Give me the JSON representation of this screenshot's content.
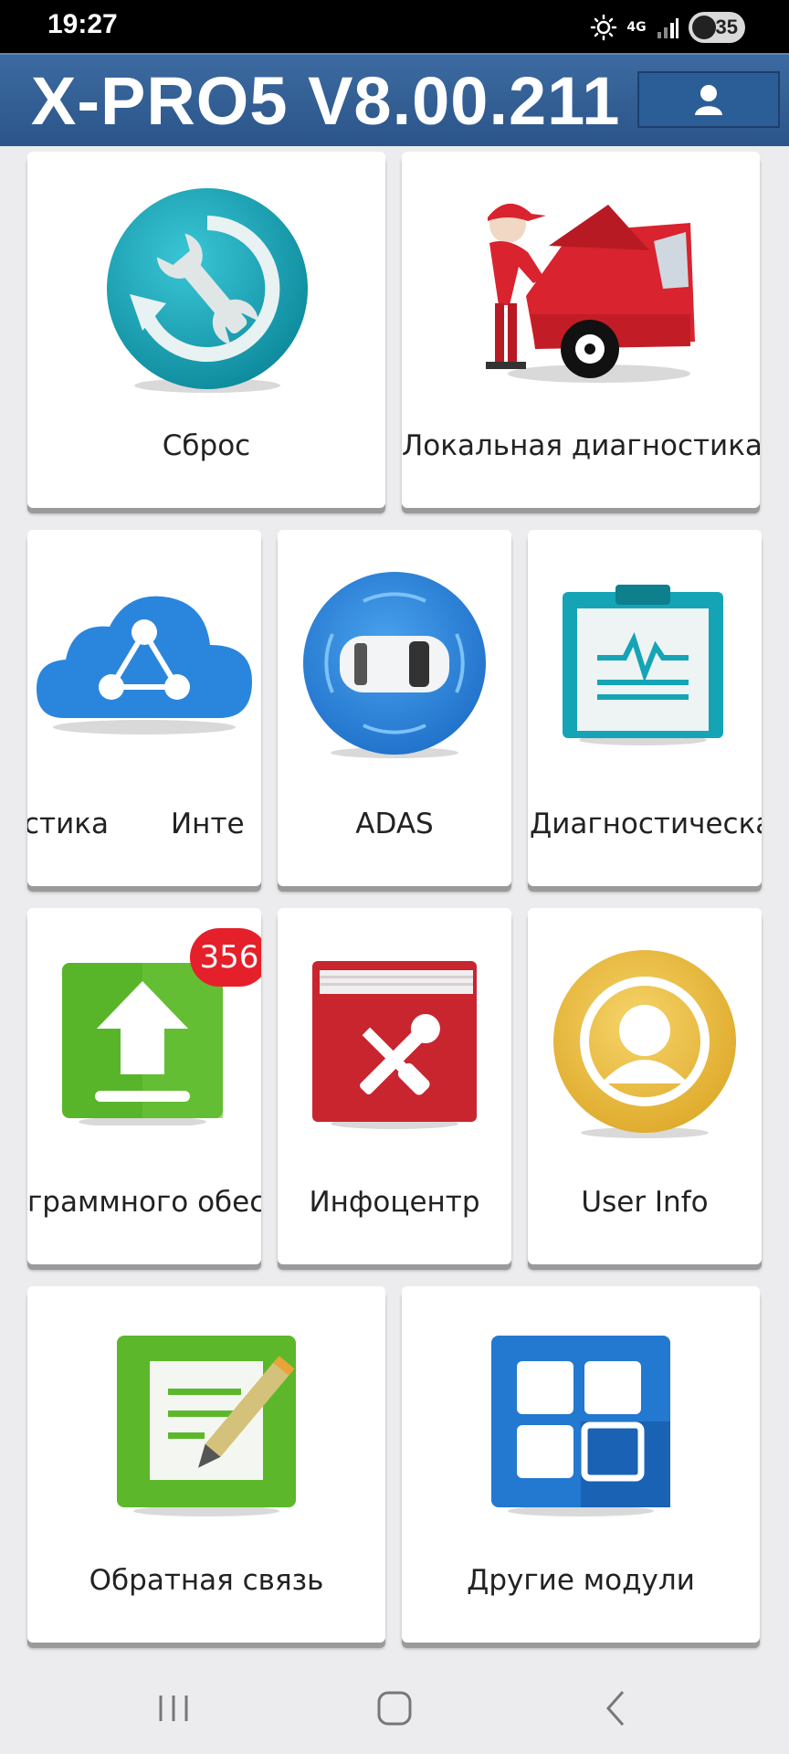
{
  "status_bar": {
    "time": "19:27",
    "network": "4G",
    "battery": "35"
  },
  "header": {
    "title": "X-PRO5 V8.00.211"
  },
  "tiles": [
    {
      "label": "Сброс",
      "icon": "reset-wrench-icon"
    },
    {
      "label": "Локальная диагностика",
      "icon": "mechanic-car-icon"
    },
    {
      "label_left": "стика",
      "label_right": "Инте",
      "icon": "cloud-share-icon"
    },
    {
      "label": "ADAS",
      "icon": "adas-car-radar-icon"
    },
    {
      "label": "Диагностическая",
      "icon": "clipboard-waveform-icon"
    },
    {
      "label": "граммного обесп",
      "icon": "upload-icon",
      "badge": "356"
    },
    {
      "label": "Инфоцентр",
      "icon": "tool-book-icon"
    },
    {
      "label": "User Info",
      "icon": "user-circle-icon"
    },
    {
      "label": "Обратная связь",
      "icon": "notepad-pencil-icon"
    },
    {
      "label": "Другие модули",
      "icon": "grid-modules-icon"
    }
  ],
  "colors": {
    "header": "#2b558a",
    "badge": "#e5202a",
    "background": "#ececee"
  }
}
